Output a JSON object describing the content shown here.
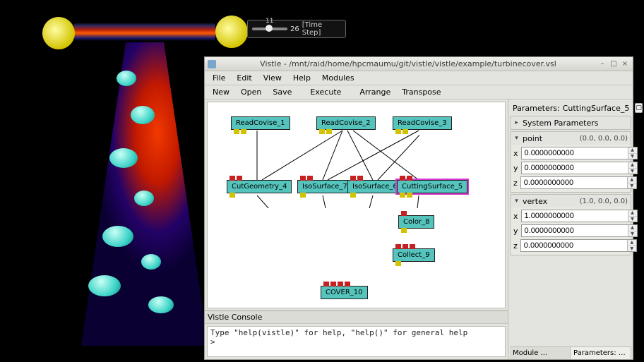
{
  "timeslider": {
    "current": 11,
    "max": 26,
    "label": "[Time Step]",
    "pct": 42
  },
  "window": {
    "title": "Vistle - /mnt/raid/home/hpcmaumu/git/vistle/vistle/example/turbinecover.vsl",
    "menu": [
      "File",
      "Edit",
      "View",
      "Help",
      "Modules"
    ],
    "toolbar": [
      "New",
      "Open",
      "Save",
      "Execute",
      "Arrange",
      "Transpose"
    ]
  },
  "nodes": {
    "readcovise1": {
      "label": "ReadCovise_1"
    },
    "readcovise2": {
      "label": "ReadCovise_2"
    },
    "readcovise3": {
      "label": "ReadCovise_3"
    },
    "cutgeometry4": {
      "label": "CutGeometry_4"
    },
    "isosurface7": {
      "label": "IsoSurface_7"
    },
    "isosurface6": {
      "label": "IsoSurface_6"
    },
    "cuttingsurf5": {
      "label": "CuttingSurface_5"
    },
    "color8": {
      "label": "Color_8"
    },
    "collect9": {
      "label": "Collect_9"
    },
    "cover10": {
      "label": "COVER_10"
    }
  },
  "parameters": {
    "title_prefix": "Parameters:",
    "title_module": "CuttingSurface_5",
    "system_label": "System Parameters",
    "groups": [
      {
        "key": "point",
        "label": "point",
        "summary": "(0.0, 0.0, 0.0)",
        "fields": [
          {
            "k": "x",
            "v": "0.0000000000"
          },
          {
            "k": "y",
            "v": "0.0000000000"
          },
          {
            "k": "z",
            "v": "0.0000000000"
          }
        ]
      },
      {
        "key": "vertex",
        "label": "vertex",
        "summary": "(1.0, 0.0, 0.0)",
        "fields": [
          {
            "k": "x",
            "v": "1.0000000000"
          },
          {
            "k": "y",
            "v": "0.0000000000"
          },
          {
            "k": "z",
            "v": "0.0000000000"
          }
        ]
      }
    ],
    "tabs": [
      {
        "label": "Module ...",
        "active": false
      },
      {
        "label": "Parameters: CuttingS...",
        "active": true
      }
    ]
  },
  "console": {
    "label": "Vistle Console",
    "text": "Type \"help(vistle)\" for help, \"help()\" for general help\n>"
  }
}
